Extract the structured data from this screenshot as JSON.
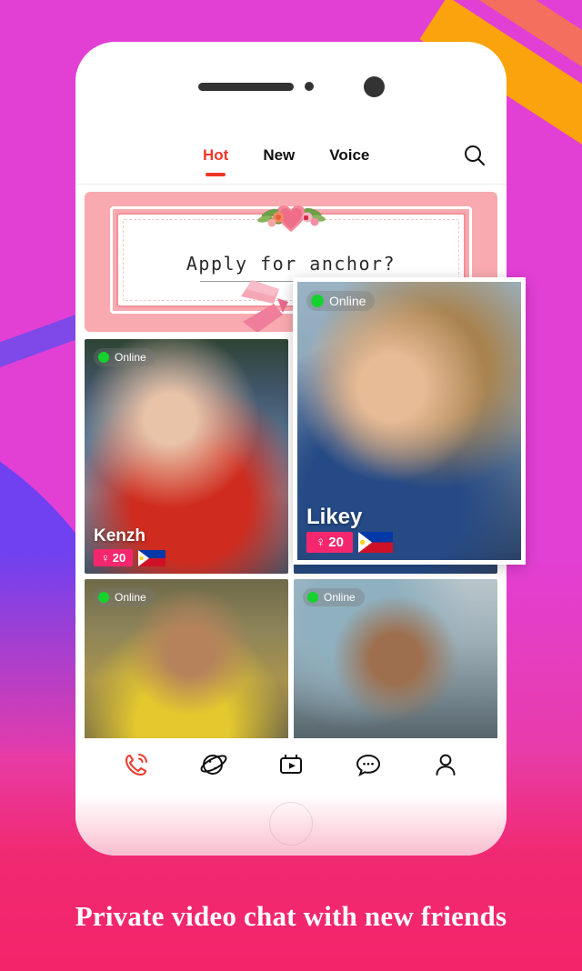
{
  "background": {
    "magenta": "#E23FD5",
    "coral_stripe": "#F3705E",
    "orange_stripe": "#FBA30C",
    "purple_blob": "#6F41F0",
    "bottom_gradient_start": "#E83CA8",
    "bottom_gradient_end": "#F4246A"
  },
  "caption": {
    "text": "Private video chat with new friends"
  },
  "phone": {
    "hardware": {
      "speaker_name": "speaker-bar",
      "sensor_name": "sensor-dot",
      "camera_name": "front-camera",
      "home_button_name": "home-button"
    }
  },
  "header": {
    "tabs": [
      {
        "label": "Hot",
        "active": true
      },
      {
        "label": "New",
        "active": false
      },
      {
        "label": "Voice",
        "active": false
      }
    ],
    "active_color": "#F0372B",
    "search_icon": "search-icon"
  },
  "banner": {
    "title": "Apply for anchor?",
    "background": "#F8AAB0",
    "decorations": [
      "heart-floral-icon",
      "ribbon-bow-icon"
    ],
    "dots": 3
  },
  "cards": [
    {
      "name": "Kenzh",
      "status": "Online",
      "status_color": "#16D12E",
      "gender_symbol": "♀",
      "age": "20",
      "country": "Philippines",
      "flag": "philippines-flag",
      "position": "grid-left-top",
      "photo": "p-kenzh"
    },
    {
      "name": "",
      "status": "Online",
      "status_color": "#16D12E",
      "gender_symbol": "",
      "age": "",
      "country": "",
      "flag": "",
      "position": "grid-left-bottom",
      "photo": "p-yellow"
    },
    {
      "name": "",
      "status": "Online",
      "status_color": "#16D12E",
      "gender_symbol": "",
      "age": "",
      "country": "",
      "flag": "",
      "position": "grid-right-bottom",
      "photo": "p-glasses"
    }
  ],
  "featured_card": {
    "name": "Likey",
    "status": "Online",
    "status_color": "#16D12E",
    "gender_symbol": "♀",
    "age": "20",
    "country": "Philippines",
    "flag": "philippines-flag",
    "badge_color": "#F4276E",
    "photo": "p-likey"
  },
  "bottom_nav": {
    "active_color": "#F0372B",
    "items": [
      {
        "icon": "call-icon",
        "label": "Call",
        "active": true
      },
      {
        "icon": "planet-discover-icon",
        "label": "Discover",
        "active": false
      },
      {
        "icon": "video-tv-icon",
        "label": "Live",
        "active": false
      },
      {
        "icon": "chat-bubble-icon",
        "label": "Messages",
        "active": false
      },
      {
        "icon": "person-profile-icon",
        "label": "Profile",
        "active": false
      }
    ]
  }
}
